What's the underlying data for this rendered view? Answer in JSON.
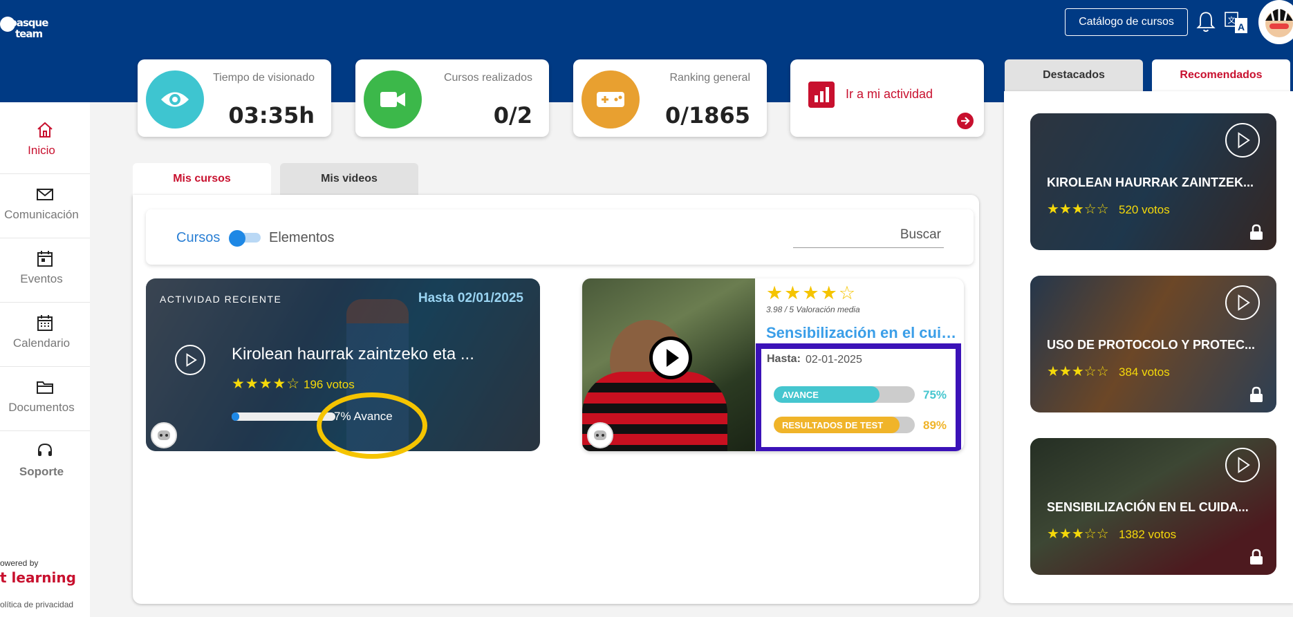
{
  "header": {
    "logo_top": "basque",
    "logo_bottom": "team",
    "catalog_button": "Catálogo de cursos"
  },
  "sidebar": {
    "items": [
      {
        "label": "Inicio",
        "icon": "home-icon",
        "active": true
      },
      {
        "label": "Comunicación",
        "icon": "mail-icon"
      },
      {
        "label": "Eventos",
        "icon": "calendar-event-icon"
      },
      {
        "label": "Calendario",
        "icon": "calendar-icon"
      },
      {
        "label": "Documentos",
        "icon": "folder-icon"
      },
      {
        "label": "Soporte",
        "icon": "headset-icon"
      }
    ],
    "powered_by": "owered by",
    "brand": "t learning",
    "privacy": "olítica de privacidad"
  },
  "stats": [
    {
      "label": "Tiempo de visionado",
      "value": "03:35h",
      "icon": "eye-icon",
      "color": "#3ec5d0"
    },
    {
      "label": "Cursos realizados",
      "value": "0/2",
      "icon": "video-camera-icon",
      "color": "#3cb84a"
    },
    {
      "label": "Ranking general",
      "value": "0/1865",
      "icon": "gamepad-icon",
      "color": "#e8a030"
    }
  ],
  "activity_link": {
    "label": "Ir a mi actividad"
  },
  "tabs": {
    "active": "Mis cursos",
    "inactive": "Mis videos"
  },
  "filter": {
    "left": "Cursos",
    "right": "Elementos",
    "search_placeholder": "Buscar"
  },
  "recent": {
    "tag": "ACTIVIDAD RECIENTE",
    "date": "Hasta 02/01/2025",
    "title": "Kirolean haurrak zaintzeko eta ...",
    "stars": "★★★★☆",
    "rating": 4,
    "votes": "196 votos",
    "progress_pct": 7,
    "progress_text": "7% Avance"
  },
  "course": {
    "stars": "★★★★☆",
    "rating_text": "3.98 / 5 Valoración media",
    "title": "Sensibilización en el cuidado",
    "hasta_label": "Hasta:",
    "hasta_value": "02-01-2025",
    "avance_label": "AVANCE",
    "avance_pct": 75,
    "avance_text": "75%",
    "test_label": "RESULTADOS DE TEST",
    "test_pct": 89,
    "test_text": "89%"
  },
  "right_tabs": {
    "inactive": "Destacados",
    "active": "Recomendados"
  },
  "recommended": [
    {
      "title": "KIROLEAN HAURRAK ZAINTZEK...",
      "stars": "★★★☆☆",
      "votes": "520 votos"
    },
    {
      "title": "USO DE PROTOCOLO Y PROTEC...",
      "stars": "★★★☆☆",
      "votes": "384 votos"
    },
    {
      "title": "SENSIBILIZACIÓN EN EL CUIDA...",
      "stars": "★★★☆☆",
      "votes": "1382 votos"
    }
  ],
  "colors": {
    "brand_blue": "#003a84",
    "accent_red": "#c8102e",
    "link_blue": "#2a7fd4",
    "star_yellow": "#f5d90a",
    "avance_teal": "#45c6cf",
    "test_amber": "#f0b429",
    "highlight_yellow": "#f5c400",
    "highlight_purple": "#3b12b8"
  }
}
